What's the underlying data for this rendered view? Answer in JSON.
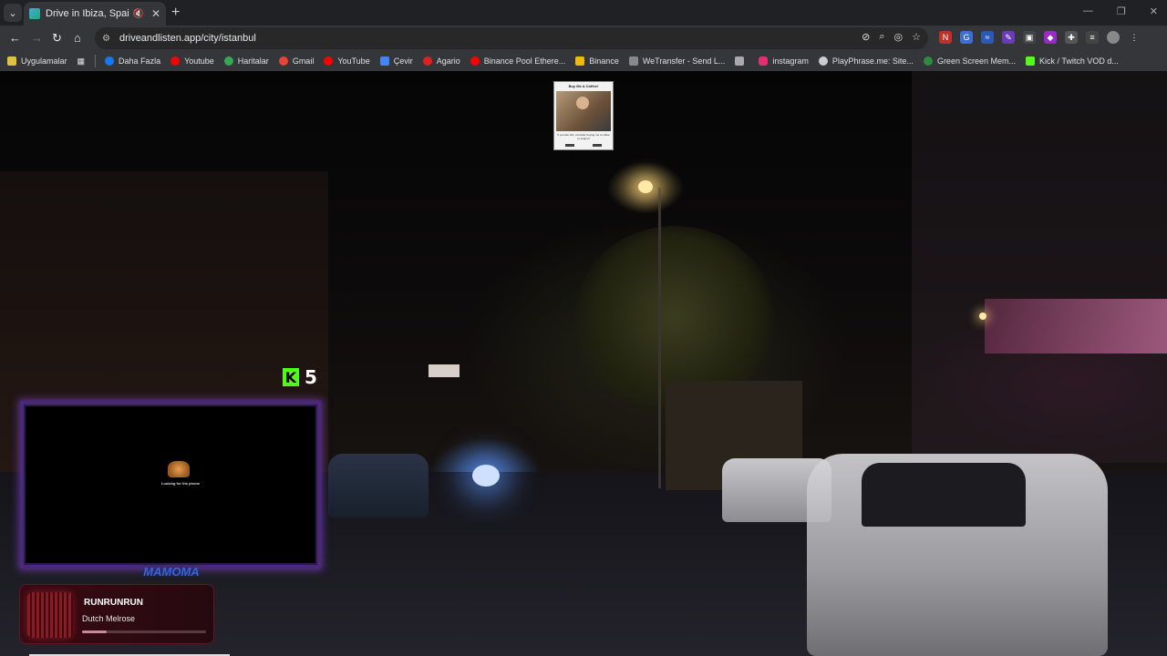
{
  "browser": {
    "tab_title": "Drive in Ibiza, Spain - Drive",
    "url": "driveandlisten.app/city/istanbul"
  },
  "bookmarks": [
    {
      "label": "Uygulamalar",
      "icon": "apps-grid-icon",
      "color": "#e0c040"
    },
    {
      "label": "Daha Fazla",
      "icon": "facebook-icon",
      "color": "#1877f2"
    },
    {
      "label": "Youtube",
      "icon": "youtube-icon",
      "color": "#ff0000"
    },
    {
      "label": "Haritalar",
      "icon": "maps-icon",
      "color": "#34a853"
    },
    {
      "label": "Gmail",
      "icon": "gmail-icon",
      "color": "#ea4335"
    },
    {
      "label": "YouTube",
      "icon": "youtube-icon",
      "color": "#ff0000"
    },
    {
      "label": "Çevir",
      "icon": "translate-icon",
      "color": "#4285f4"
    },
    {
      "label": "Agario",
      "icon": "agario-icon",
      "color": "#e02020"
    },
    {
      "label": "Binance Pool Ethere...",
      "icon": "youtube-icon",
      "color": "#ff0000"
    },
    {
      "label": "Binance",
      "icon": "binance-icon",
      "color": "#f0b90b"
    },
    {
      "label": "WeTransfer - Send L...",
      "icon": "wetransfer-icon",
      "color": "#888888"
    },
    {
      "label": "",
      "icon": "bookmark-icon",
      "color": "#aaaaaa"
    },
    {
      "label": "instagram",
      "icon": "instagram-icon",
      "color": "#e1306c"
    },
    {
      "label": "PlayPhrase.me: Site...",
      "icon": "playphrase-icon",
      "color": "#cccccc"
    },
    {
      "label": "Green Screen Mem...",
      "icon": "green-screen-icon",
      "color": "#2e8b3e"
    },
    {
      "label": "Kick / Twitch VOD d...",
      "icon": "kick-icon",
      "color": "#53fc18"
    }
  ],
  "overlay": {
    "donate": {
      "title": "Buy Me A Coffee!",
      "text": "If you like this, consider buying me a coffee to support"
    },
    "kick_count": "5",
    "camera": {
      "loading_text": "Looking for the phone",
      "brand": "MAMOMA"
    },
    "player": {
      "track": "RUNRUNRUN",
      "artist": "Dutch Melrose",
      "progress": 0.2
    }
  }
}
